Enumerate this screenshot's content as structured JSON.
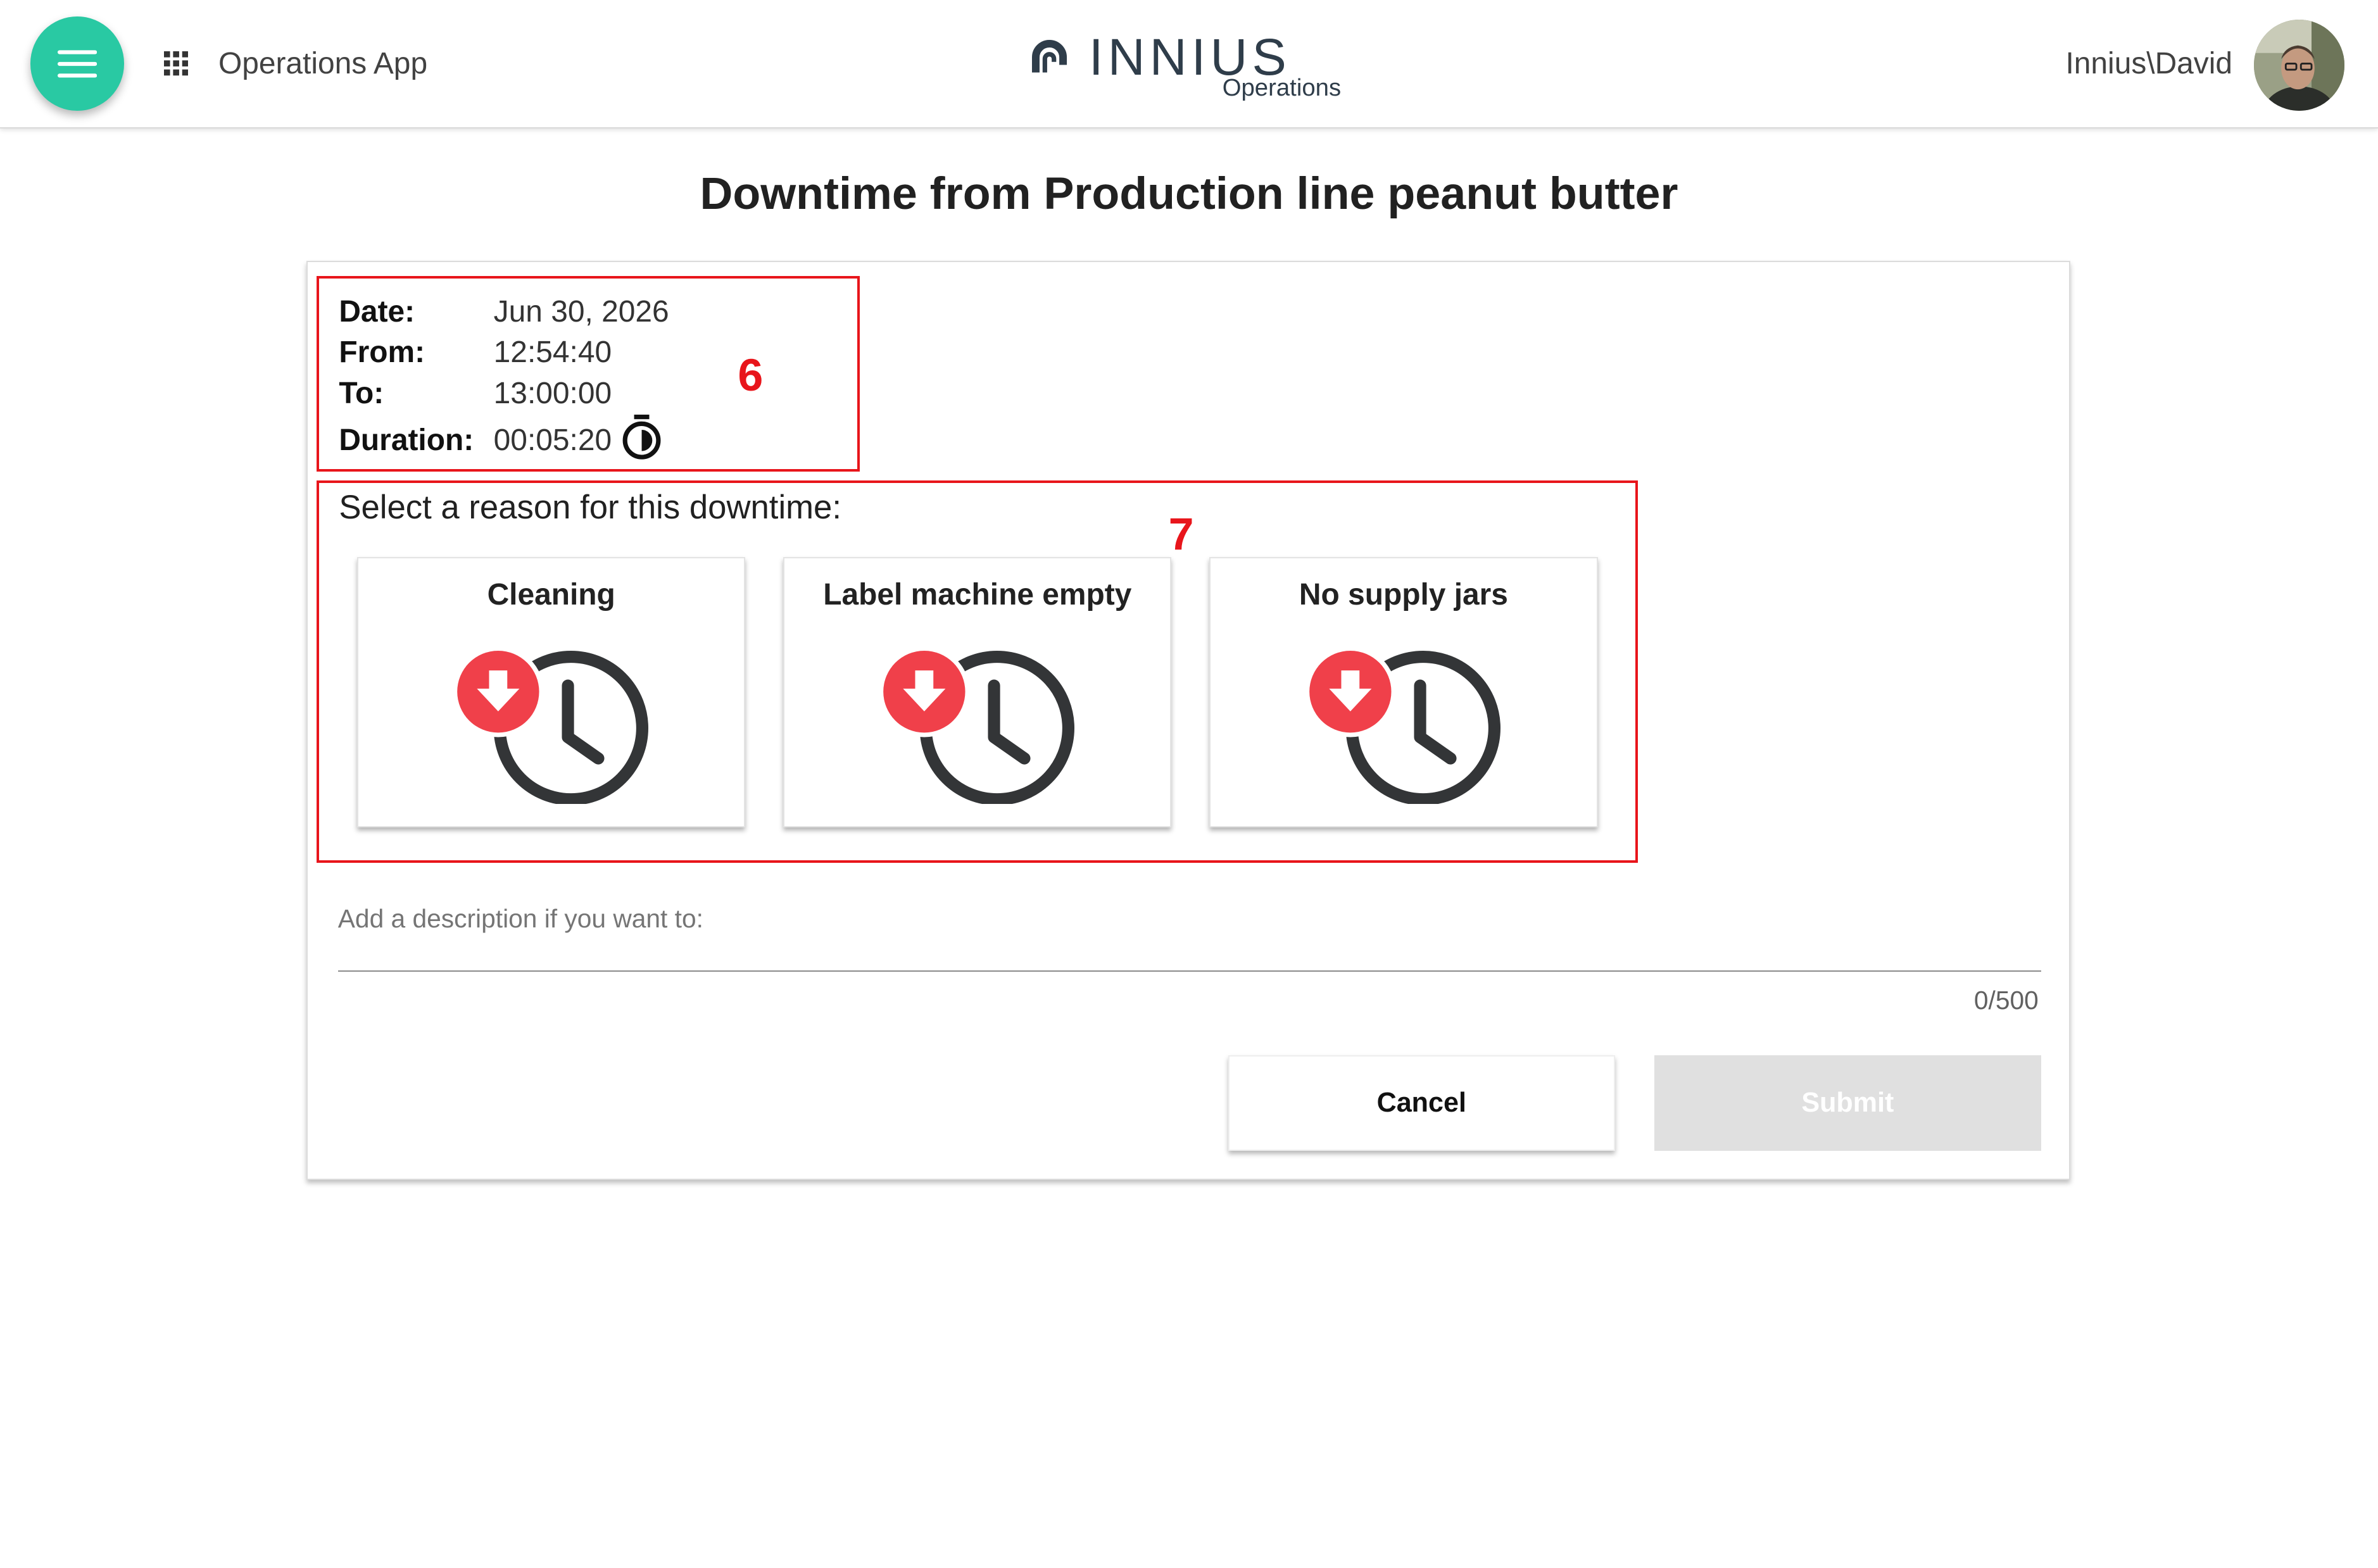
{
  "header": {
    "app_name": "Operations App",
    "brand_name": "INNIUS",
    "brand_sub": "Operations",
    "user_name": "Innius\\David",
    "accent_color": "#29c9a3"
  },
  "page": {
    "title": "Downtime from Production line peanut butter"
  },
  "downtime": {
    "date_label": "Date:",
    "date_value": "Jun 30, 2026",
    "from_label": "From:",
    "from_value": "12:54:40",
    "to_label": "To:",
    "to_value": "13:00:00",
    "duration_label": "Duration:",
    "duration_value": "00:05:20"
  },
  "annotations": {
    "info_marker": "6",
    "reason_marker": "7",
    "color": "#e8151b"
  },
  "reasons": {
    "prompt": "Select a reason for this downtime:",
    "items": [
      {
        "label": "Cleaning",
        "icon": "downtime-clock-icon"
      },
      {
        "label": "Label machine empty",
        "icon": "downtime-clock-icon"
      },
      {
        "label": "No supply jars",
        "icon": "downtime-clock-icon"
      }
    ]
  },
  "description": {
    "placeholder": "Add a description if you want to:",
    "counter": "0/500"
  },
  "actions": {
    "cancel_label": "Cancel",
    "submit_label": "Submit"
  }
}
